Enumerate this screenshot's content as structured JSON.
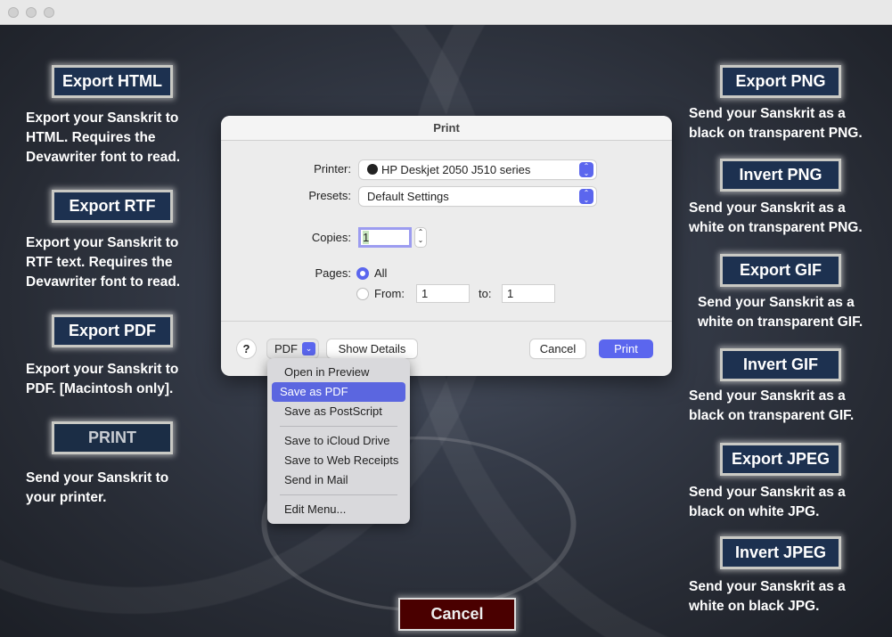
{
  "window": {
    "title": ""
  },
  "left": [
    {
      "button": "Export HTML",
      "lines": [
        "Export your Sanskrit to",
        "HTML. Requires the",
        "Devawriter font to read."
      ]
    },
    {
      "button": "Export RTF",
      "lines": [
        "Export your Sanskrit to",
        "RTF text. Requires the",
        "Devawriter font to read."
      ]
    },
    {
      "button": "Export PDF",
      "lines": [
        "Export your Sanskrit to",
        "PDF. [Macintosh only]."
      ]
    },
    {
      "button": "PRINT",
      "lines": [
        "Send your Sanskrit to",
        "your printer."
      ]
    }
  ],
  "right": [
    {
      "button": "Export PNG",
      "lines": [
        "Send your Sanskrit as a",
        "black on transparent PNG."
      ]
    },
    {
      "button": "Invert PNG",
      "lines": [
        "Send your Sanskrit as a",
        "white on transparent PNG."
      ]
    },
    {
      "button": "Export GIF",
      "lines": [
        "Send your Sanskrit as a",
        "white on transparent GIF."
      ]
    },
    {
      "button": "Invert GIF",
      "lines": [
        "Send your Sanskrit as a",
        "black on transparent GIF."
      ]
    },
    {
      "button": "Export JPEG",
      "lines": [
        "Send your Sanskrit as a",
        "black on white JPG."
      ]
    },
    {
      "button": "Invert JPEG",
      "lines": [
        "Send your Sanskrit as a",
        "white on black JPG."
      ]
    }
  ],
  "cancel": "Cancel",
  "dialog": {
    "title": "Print",
    "printer_label": "Printer:",
    "printer": "HP Deskjet 2050 J510 series",
    "presets_label": "Presets:",
    "presets": "Default Settings",
    "copies_label": "Copies:",
    "copies": "1",
    "pages_label": "Pages:",
    "all": "All",
    "from": "From:",
    "from_value": "1",
    "to": "to:",
    "to_value": "1",
    "help": "?",
    "pdf": "PDF",
    "show_details": "Show Details",
    "cancel": "Cancel",
    "print": "Print"
  },
  "pdf_menu": {
    "items": [
      "Open in Preview",
      "Save as PDF",
      "Save as PostScript",
      "Save to iCloud Drive",
      "Save to Web Receipts",
      "Send in Mail",
      "Edit Menu..."
    ],
    "selected": "Save as PDF"
  },
  "colors": {
    "accent": "#5b66ee",
    "button_bg": "#1d3150",
    "cancel_bg": "#4a0000"
  }
}
